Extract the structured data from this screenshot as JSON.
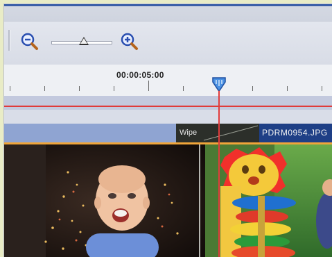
{
  "toolbar": {
    "zoom_out_icon": "zoom-out-icon",
    "zoom_in_icon": "zoom-in-icon",
    "zoom_slider_value": 0.48
  },
  "ruler": {
    "timecode": "00:00:05:00"
  },
  "timeline": {
    "transition_label": "Wipe",
    "clip_label": "PDRM0954.JPG"
  },
  "colors": {
    "playhead": "#e23b3b",
    "track_blue": "#8fa4d2",
    "clip_blue": "#1e3f86",
    "work_area": "#f0a53a"
  }
}
